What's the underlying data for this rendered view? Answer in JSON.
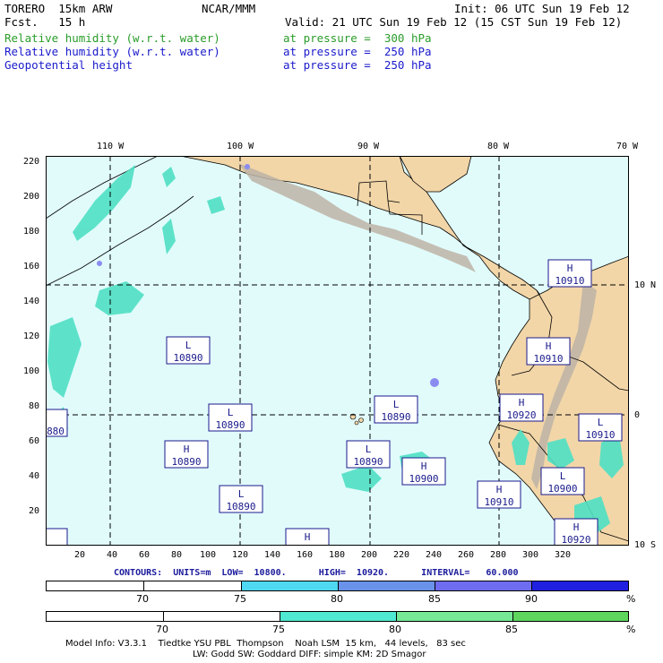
{
  "header": {
    "model": "TORERO  15km ARW",
    "org": "NCAR/MMM",
    "init": "Init: 06 UTC Sun 19 Feb 12",
    "fcst": "Fcst.   15 h",
    "valid": "Valid: 21 UTC Sun 19 Feb 12 (15 CST Sun 19 Feb 12)",
    "fields": [
      {
        "name": "Relative humidity (w.r.t. water)",
        "level": "at pressure =  300 hPa",
        "color": "#2a9d2a"
      },
      {
        "name": "Relative humidity (w.r.t. water)",
        "level": "at pressure =  250 hPa",
        "color": "#1a1acc"
      },
      {
        "name": "Geopotential height",
        "level": "at pressure =  250 hPa",
        "color": "#1a1acc"
      }
    ]
  },
  "map": {
    "top_lon_labels": [
      "110 W",
      "100 W",
      "90 W",
      "80 W",
      "70 W"
    ],
    "right_lat_labels": [
      "10 N",
      "0",
      "10 S"
    ],
    "left_ticks": [
      "220",
      "200",
      "180",
      "160",
      "140",
      "120",
      "100",
      "80",
      "60",
      "40",
      "20"
    ],
    "bottom_ticks": [
      "20",
      "40",
      "60",
      "80",
      "100",
      "120",
      "140",
      "160",
      "180",
      "200",
      "220",
      "240",
      "260",
      "280",
      "300",
      "320"
    ],
    "colors": {
      "ocean": "#e1fbfb",
      "land": "#f2d6a8",
      "terrain": "#bdb3a6",
      "rh300": "#4fe0c4",
      "rh250": "#8a8cf0",
      "box": "#1a1a8c"
    },
    "highs_lows": [
      {
        "letter": "L",
        "value": "10890"
      },
      {
        "letter": "L",
        "value": "10890"
      },
      {
        "letter": "H",
        "value": "10890"
      },
      {
        "letter": "L",
        "value": "10890"
      },
      {
        "letter": "L",
        "value": "10890"
      },
      {
        "letter": "L",
        "value": "10890"
      },
      {
        "letter": "H",
        "value": "10900"
      },
      {
        "letter": "H",
        "value": "10910"
      },
      {
        "letter": "H",
        "value": "10910"
      },
      {
        "letter": "H",
        "value": "10920"
      },
      {
        "letter": "L",
        "value": "10910"
      },
      {
        "letter": "L",
        "value": "10900"
      },
      {
        "letter": "H",
        "value": "10910"
      },
      {
        "letter": "H",
        "value": "10920"
      },
      {
        "letter": "H",
        "value": ""
      },
      {
        "letter": "",
        "value": "880"
      }
    ]
  },
  "contours_line": "CONTOURS:  UNITS=m  LOW=  10800.      HIGH=  10920.      INTERVAL=   60.000",
  "colorbar_250": {
    "labels": [
      "70",
      "75",
      "80",
      "85",
      "90",
      "%"
    ],
    "colors": [
      "#ffffff",
      "#ffffff",
      "#4ed8f2",
      "#6a92ea",
      "#6e6cf0",
      "#2020e0"
    ]
  },
  "colorbar_300": {
    "labels": [
      "70",
      "75",
      "80",
      "85",
      "%"
    ],
    "colors": [
      "#ffffff",
      "#ffffff",
      "#4fe8d0",
      "#76e896",
      "#5ed65e"
    ]
  },
  "footer": {
    "line1": "Model Info: V3.3.1    Tiedtke YSU PBL  Thompson    Noah LSM  15 km,   44 levels,   83 sec",
    "line2": "LW: Godd SW: Goddard DIFF: simple KM: 2D Smagor"
  }
}
